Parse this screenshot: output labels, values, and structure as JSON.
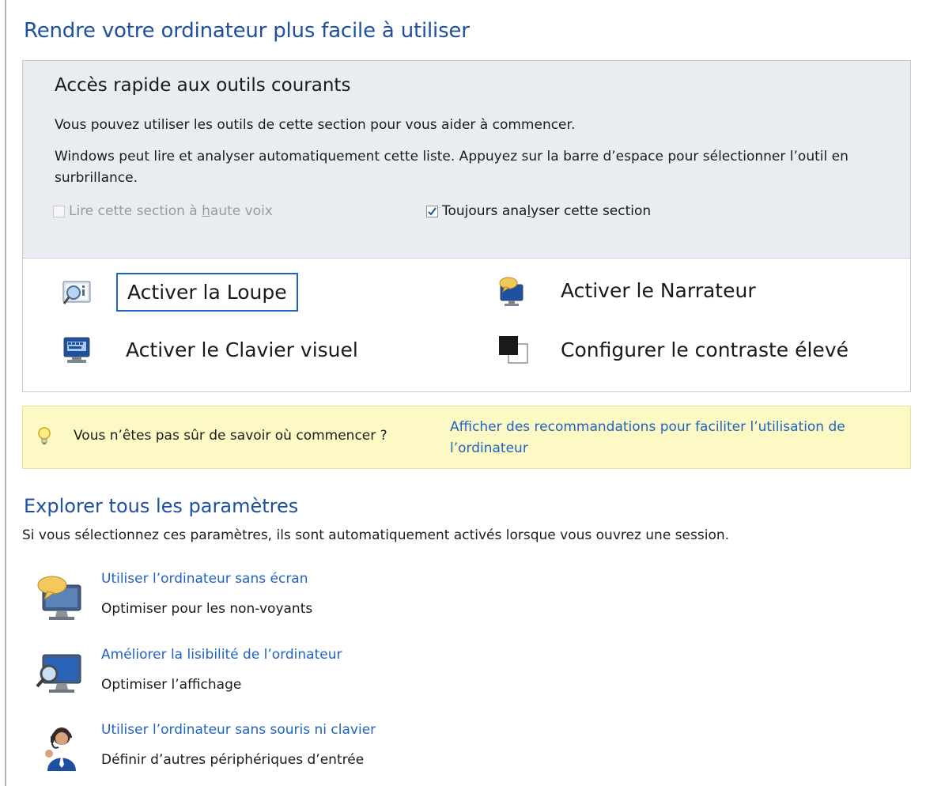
{
  "page": {
    "title": "Rendre votre ordinateur plus facile à utiliser"
  },
  "quick_access": {
    "heading": "Accès rapide aux outils courants",
    "intro": "Vous pouvez utiliser les outils de cette section pour vous aider à commencer.",
    "scan_info": "Windows peut lire et analyser automatiquement cette liste. Appuyez sur la barre d’espace pour sélectionner l’outil en surbrillance.",
    "read_aloud": {
      "label_before": "Lire cette section à ",
      "label_accel": "h",
      "label_after": "aute voix",
      "checked": false,
      "enabled": false
    },
    "always_scan": {
      "label_before": "Toujours ana",
      "label_accel": "l",
      "label_after": "yser cette section",
      "checked": true,
      "enabled": true
    },
    "tools": [
      {
        "label": "Activer la Loupe",
        "icon": "magnifier-icon",
        "focused": true
      },
      {
        "label": "Activer le Narrateur",
        "icon": "narrator-icon",
        "focused": false
      },
      {
        "label": "Activer le Clavier visuel",
        "icon": "on-screen-keyboard-icon",
        "focused": false
      },
      {
        "label": "Configurer le contraste élevé",
        "icon": "high-contrast-icon",
        "focused": false
      }
    ]
  },
  "tip": {
    "icon": "lightbulb-icon",
    "text": "Vous n’êtes pas sûr de savoir où commencer ?",
    "link": "Afficher des recommandations pour faciliter l’utilisation de l’ordinateur"
  },
  "explore": {
    "title": "Explorer tous les paramètres",
    "description": "Si vous sélectionnez ces paramètres, ils sont automatiquement activés lorsque vous ouvrez une session.",
    "items": [
      {
        "link": "Utiliser l’ordinateur sans écran",
        "desc": "Optimiser pour les non-voyants",
        "icon": "monitor-speech-icon"
      },
      {
        "link": "Améliorer la lisibilité de l’ordinateur",
        "desc": "Optimiser l’affichage",
        "icon": "monitor-magnifier-icon"
      },
      {
        "link": "Utiliser l’ordinateur sans souris ni clavier",
        "desc": "Définir d’autres périphériques d’entrée",
        "icon": "person-headset-icon"
      }
    ]
  },
  "colors": {
    "heading_blue": "#1f4f9f",
    "link_blue": "#1f63c0",
    "focus_border": "#1d64c4",
    "panel_gray": "#e9ecf1",
    "tip_yellow": "#fcf9c4"
  }
}
